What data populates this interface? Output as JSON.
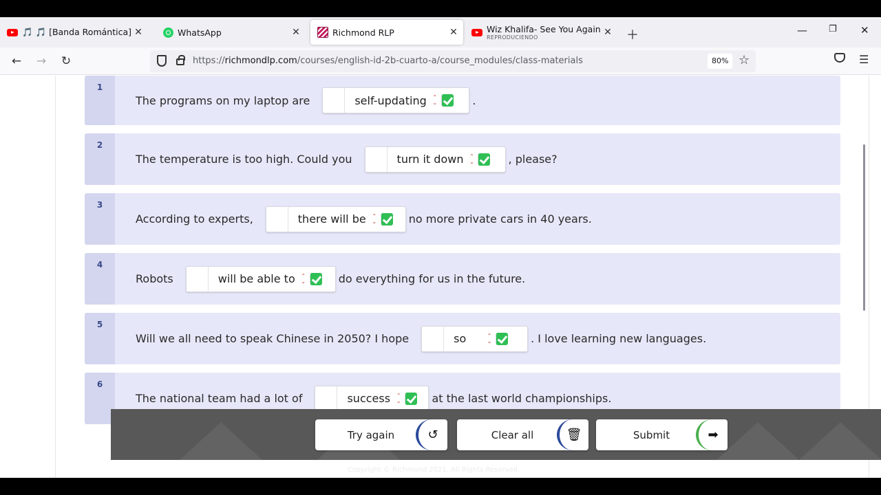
{
  "browser": {
    "tabs": [
      {
        "icon": "youtube-icon",
        "title": "🎵 🎵 [Banda Romántica] Tú - I",
        "active": false
      },
      {
        "icon": "whatsapp-icon",
        "title": "WhatsApp",
        "active": false
      },
      {
        "icon": "richmond-icon",
        "title": "Richmond RLP",
        "active": true
      },
      {
        "icon": "youtube-icon",
        "title": "Wiz Khalifa- See You Again Ft:Cl",
        "subtitle": "REPRODUCIENDO",
        "active": false
      }
    ],
    "url_prefix": "https://",
    "url_host": "richmondlp.com",
    "url_path": "/courses/english-id-2b-cuarto-a/course_modules/class-materials",
    "zoom": "80%"
  },
  "questions": [
    {
      "num": "1",
      "before": "The programs on my laptop are",
      "answer": "self-updating",
      "after": "."
    },
    {
      "num": "2",
      "before": "The temperature is too high. Could you",
      "answer": "turn it down",
      "after": ", please?"
    },
    {
      "num": "3",
      "before": "According to experts,",
      "answer": "there will be",
      "after": "no more private cars in 40 years."
    },
    {
      "num": "4",
      "before": "Robots",
      "answer": "will be able to",
      "after": "do everything for us in the future."
    },
    {
      "num": "5",
      "before": "Will we all need to speak Chinese in 2050? I hope",
      "answer": "so",
      "after": ". I love learning new languages."
    },
    {
      "num": "6",
      "before": "The national team had a lot of",
      "answer": "success",
      "after": "at the last world championships."
    }
  ],
  "actions": {
    "try_again": "Try again",
    "clear_all": "Clear all",
    "submit": "Submit"
  },
  "footer": {
    "copyright": "Copyright © Richmond 2021. All Rights Reserved."
  },
  "colors": {
    "question_bg": "#e6e7f8",
    "number_bg": "#d4d6ef",
    "check_green": "#2fbf55",
    "caret_red": "#c0392b",
    "action_bar": "#585858"
  }
}
